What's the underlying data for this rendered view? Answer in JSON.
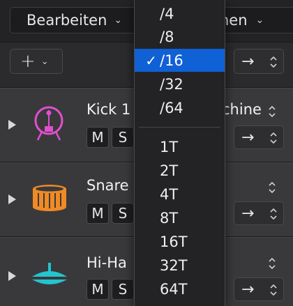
{
  "toolbar": {
    "edit_menu_label": "Bearbeiten",
    "right_menu_label_partial": "nen",
    "add_label": "+"
  },
  "tracks": [
    {
      "name": "Kick 1",
      "name_suffix": "chine",
      "mute": "M",
      "solo": "S",
      "icon": "kick-drum-icon",
      "color": "#e24fcf"
    },
    {
      "name": "Snare",
      "mute": "M",
      "solo": "S",
      "icon": "snare-drum-icon",
      "color": "#f08a24"
    },
    {
      "name": "Hi-Ha",
      "mute": "M",
      "solo": "S",
      "icon": "hi-hat-icon",
      "color": "#23c4cf"
    }
  ],
  "division_menu": {
    "items": [
      "/4",
      "/8",
      "/16",
      "/32",
      "/64"
    ],
    "triplet_items": [
      "1T",
      "2T",
      "4T",
      "8T",
      "16T",
      "32T",
      "64T"
    ],
    "selected": "/16",
    "check": "✓",
    "accent": "#1060d6"
  },
  "arrow_glyph": "→"
}
